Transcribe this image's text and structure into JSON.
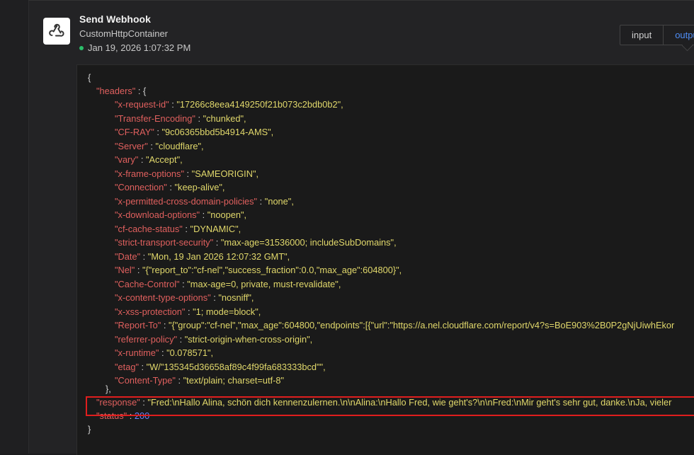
{
  "node": {
    "title": "Send Webhook",
    "subtitle": "CustomHttpContainer",
    "timestamp": "Jan 19, 2026 1:07:32 PM",
    "status_color": "#2bbf6a",
    "icon": "webhook-icon"
  },
  "tabs": [
    {
      "label": "input",
      "active": false
    },
    {
      "label": "output",
      "active": true
    }
  ],
  "json": {
    "open_brace": "{",
    "headers_key": "\"headers\"",
    "headers": [
      {
        "key": "\"x-request-id\"",
        "value": "\"17266c8eea4149250f21b073c2bdb0b2\","
      },
      {
        "key": "\"Transfer-Encoding\"",
        "value": "\"chunked\","
      },
      {
        "key": "\"CF-RAY\"",
        "value": "\"9c06365bbd5b4914-AMS\","
      },
      {
        "key": "\"Server\"",
        "value": "\"cloudflare\","
      },
      {
        "key": "\"vary\"",
        "value": "\"Accept\","
      },
      {
        "key": "\"x-frame-options\"",
        "value": "\"SAMEORIGIN\","
      },
      {
        "key": "\"Connection\"",
        "value": "\"keep-alive\","
      },
      {
        "key": "\"x-permitted-cross-domain-policies\"",
        "value": "\"none\","
      },
      {
        "key": "\"x-download-options\"",
        "value": "\"noopen\","
      },
      {
        "key": "\"cf-cache-status\"",
        "value": "\"DYNAMIC\","
      },
      {
        "key": "\"strict-transport-security\"",
        "value": "\"max-age=31536000; includeSubDomains\","
      },
      {
        "key": "\"Date\"",
        "value": "\"Mon, 19 Jan 2026 12:07:32 GMT\","
      },
      {
        "key": "\"Nel\"",
        "value": "\"{\"report_to\":\"cf-nel\",\"success_fraction\":0.0,\"max_age\":604800}\","
      },
      {
        "key": "\"Cache-Control\"",
        "value": "\"max-age=0, private, must-revalidate\","
      },
      {
        "key": "\"x-content-type-options\"",
        "value": "\"nosniff\","
      },
      {
        "key": "\"x-xss-protection\"",
        "value": "\"1; mode=block\","
      },
      {
        "key": "\"Report-To\"",
        "value": "\"{\"group\":\"cf-nel\",\"max_age\":604800,\"endpoints\":[{\"url\":\"https://a.nel.cloudflare.com/report/v4?s=BoE903%2B0P2gNjUiwhEkor"
      },
      {
        "key": "\"referrer-policy\"",
        "value": "\"strict-origin-when-cross-origin\","
      },
      {
        "key": "\"x-runtime\"",
        "value": "\"0.078571\","
      },
      {
        "key": "\"etag\"",
        "value": "\"W/\"135345d36658af89c4f99fa683333bcd\"\","
      },
      {
        "key": "\"Content-Type\"",
        "value": "\"text/plain; charset=utf-8\""
      }
    ],
    "headers_close": "},",
    "response_key": "\"response\"",
    "response_value": "\"Fred:\\nHallo Alina, schön dich kennenzulernen.\\n\\nAlina:\\nHallo Fred, wie geht's?\\n\\nFred:\\nMir geht's sehr gut, danke.\\nJa, vieler",
    "status_key": "\"status\"",
    "status_value": "200",
    "close_brace": "}"
  },
  "colors": {
    "key": "#e0605e",
    "string": "#e1d86b",
    "number": "#6b82ff",
    "highlight": "#e01e1e",
    "accent": "#4f8ef7"
  }
}
